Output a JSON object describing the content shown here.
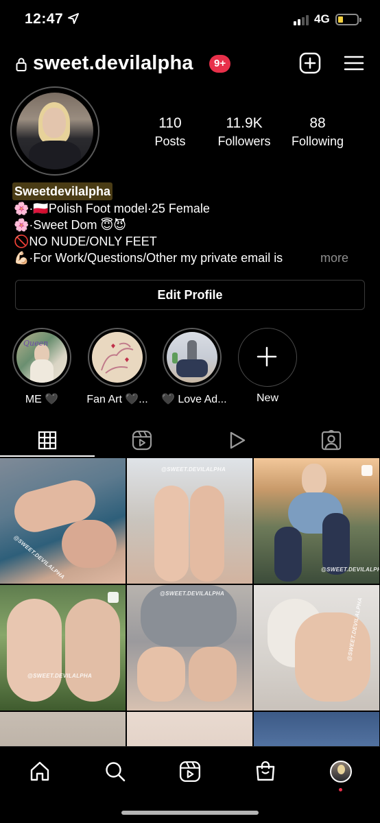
{
  "status_bar": {
    "time": "12:47",
    "network": "4G",
    "icons": [
      "location-arrow-icon",
      "signal-icon",
      "battery-icon"
    ]
  },
  "header": {
    "username": "sweet.devilalpha",
    "notification_badge": "9+",
    "icons": [
      "lock-icon",
      "add-post-icon",
      "hamburger-menu-icon"
    ]
  },
  "profile": {
    "stats": [
      {
        "value": "110",
        "label": "Posts"
      },
      {
        "value": "11.9K",
        "label": "Followers"
      },
      {
        "value": "88",
        "label": "Following"
      }
    ],
    "display_name": "Sweetdevilalpha",
    "bio": [
      {
        "prefix": "🌸·🇵🇱",
        "text": "Polish Foot model·25 Female"
      },
      {
        "prefix": "🌸",
        "text": "·Sweet Dom 😇😈"
      },
      {
        "prefix": "🚫",
        "text": "NO NUDE/ONLY FEET"
      },
      {
        "prefix": "💪🏻",
        "text": "·For Work/Questions/Other my private email is"
      }
    ],
    "more_label": "more",
    "edit_profile_label": "Edit Profile"
  },
  "highlights": [
    {
      "label": "ME 🖤"
    },
    {
      "label": "Fan Art 🖤..."
    },
    {
      "label": "🖤 Love Ad..."
    },
    {
      "label": "New"
    }
  ],
  "tabs": [
    "grid-icon",
    "reels-icon",
    "video-icon",
    "tagged-icon"
  ],
  "grid": {
    "watermark": "@SWEET.DEVILALPHA"
  },
  "bottom_nav": [
    "home-icon",
    "search-icon",
    "reels-icon",
    "shop-icon",
    "profile-avatar"
  ],
  "colors": {
    "background": "#000000",
    "badge": "#e8304a",
    "secondary_text": "#8e8e8e"
  }
}
